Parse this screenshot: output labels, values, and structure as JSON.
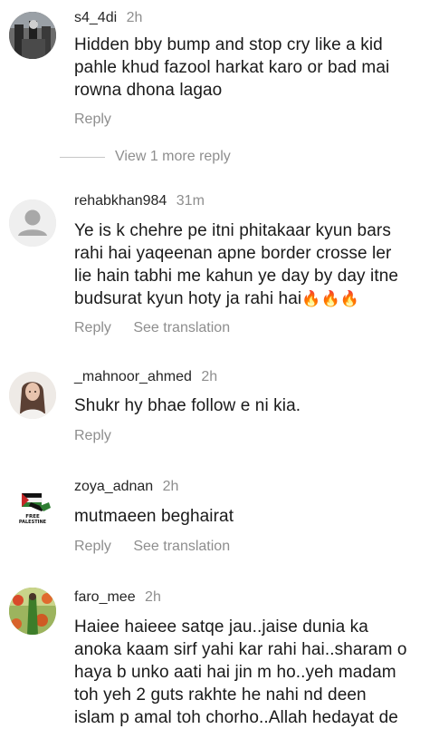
{
  "comments": [
    {
      "username": "s4_4di",
      "time": "2h",
      "lines": [
        "Hidden bby bump and stop cry like a kid",
        "pahle khud fazool harkat karo or bad mai",
        "rowna dhona lagao"
      ],
      "reply_label": "Reply"
    },
    {
      "username": "rehabkhan984",
      "time": "31m",
      "lines": [
        "Ye is k chehre pe itni phitakaar kyun bars",
        "rahi hai yaqeenan apne border crosse ler",
        "lie hain tabhi me kahun ye day by day itne",
        "budsurat kyun hoty ja rahi hai"
      ],
      "emoji": "🔥🔥🔥",
      "reply_label": "Reply",
      "translation_label": "See translation"
    },
    {
      "username": "_mahnoor_ahmed",
      "time": "2h",
      "lines": [
        "Shukr hy bhae follow e ni kia."
      ],
      "reply_label": "Reply"
    },
    {
      "username": "zoya_adnan",
      "time": "2h",
      "lines": [
        "mutmaeen beghairat"
      ],
      "reply_label": "Reply",
      "translation_label": "See translation",
      "avatar_text": [
        "FREE",
        "PALESTINE"
      ]
    },
    {
      "username": "faro_mee",
      "time": "2h",
      "lines": [
        "Haiee haieee satqe jau..jaise dunia ka",
        "anoka kaam sirf yahi kar rahi hai..sharam o",
        "haya b unko aati hai jin m ho..yeh madam",
        "toh yeh 2 guts rakhte he nahi nd deen",
        "islam p amal toh chorho..Allah hedayat de"
      ]
    }
  ],
  "view_more_label": "View 1 more reply",
  "colors": {
    "text": "#1a1a1a",
    "muted": "#8e8e8e",
    "default_avatar_bg": "#dbdbdb",
    "default_avatar_fg": "#a8a8a8"
  }
}
